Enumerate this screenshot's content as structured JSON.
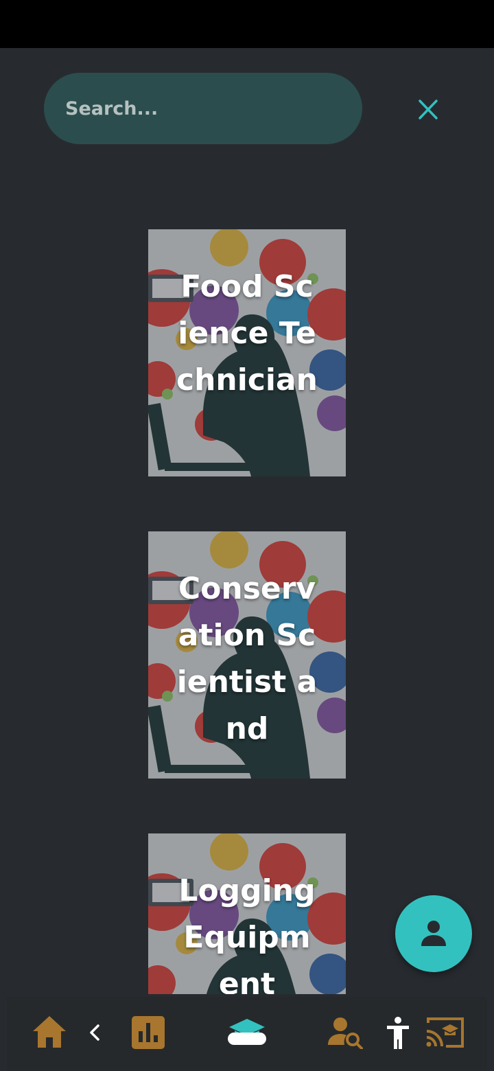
{
  "search": {
    "placeholder": "Search...",
    "value": "",
    "close_icon": "close-icon"
  },
  "results": [
    {
      "title": "Food Science Technician",
      "image": "science-education-illustration"
    },
    {
      "title": "Conservation Scientist and",
      "image": "science-education-illustration"
    },
    {
      "title": "Logging Equipment",
      "image": "science-education-illustration"
    }
  ],
  "fab": {
    "icon": "person-icon"
  },
  "nav": {
    "items": [
      "home-icon",
      "back-chevron-icon",
      "bar-chart-icon",
      "graduation-cap-icon",
      "person-search-icon",
      "accessibility-icon",
      "cast-education-icon"
    ]
  },
  "colors": {
    "background": "#272b2f",
    "accent_teal": "#33c1bf",
    "search_bg": "#2b4d4d",
    "nav_icon": "#a8762e"
  }
}
